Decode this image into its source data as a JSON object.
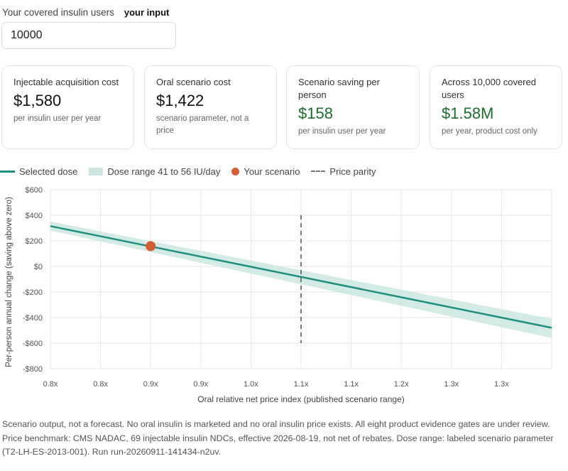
{
  "input": {
    "label": "Your covered insulin users",
    "hint": "your input",
    "value": "10000"
  },
  "cards": [
    {
      "label": "Injectable acquisition cost",
      "value": "$1,580",
      "note": "per insulin user per year",
      "accent": "#111111"
    },
    {
      "label": "Oral scenario cost",
      "value": "$1,422",
      "note": "scenario parameter, not a price",
      "accent": "#111111"
    },
    {
      "label": "Scenario saving per person",
      "value": "$158",
      "note": "per insulin user per year",
      "accent": "#1d6e2a"
    },
    {
      "label": "Across 10,000 covered users",
      "value": "$1.58M",
      "note": "per year, product cost only",
      "accent": "#1d6e2a"
    }
  ],
  "legend": {
    "selected": "Selected dose",
    "range": "Dose range 41 to 56 IU/day",
    "scenario": "Your scenario",
    "parity": "Price parity"
  },
  "colors": {
    "line": "#1f8f7e",
    "band": "#cde6e1",
    "point": "#d65c31",
    "parity": "#777777",
    "grid": "#e6e6e6"
  },
  "chart_data": {
    "type": "line",
    "xlabel": "Oral relative net price index (published scenario range)",
    "ylabel": "Per-person annual change (saving above zero)",
    "xlim": [
      0.5,
      1.5
    ],
    "ylim": [
      -800,
      600
    ],
    "x_ticks": [
      0.5,
      0.6,
      0.7,
      0.8,
      0.9,
      1.0,
      1.1,
      1.2,
      1.3,
      1.4,
      1.5
    ],
    "x_tick_labels": [
      "0.8x",
      "0.8x",
      "0.9x",
      "0.9x",
      "1.0x",
      "1.1x",
      "1.1x",
      "1.2x",
      "1.3x",
      "1.3x"
    ],
    "y_ticks": [
      600,
      400,
      200,
      0,
      -200,
      -400,
      -600,
      -800
    ],
    "y_tick_labels": [
      "$600",
      "$400",
      "$200",
      "$0",
      "-$200",
      "-$400",
      "-$600",
      "-$800"
    ],
    "grid": true,
    "legend_position": "top",
    "series": [
      {
        "name": "Selected dose",
        "x": [
          0.5,
          1.5
        ],
        "y": [
          315,
          -480
        ]
      }
    ],
    "band": {
      "name": "Dose range 41 to 56 IU/day",
      "x": [
        0.5,
        1.5
      ],
      "upper": [
        350,
        -410
      ],
      "lower": [
        280,
        -560
      ]
    },
    "point": {
      "name": "Your scenario",
      "x": 0.7,
      "y": 158
    },
    "parity": {
      "name": "Price parity",
      "x": 1.0,
      "y_range": [
        -600,
        400
      ]
    }
  },
  "footer": "Scenario output, not a forecast. No oral insulin is marketed and no oral insulin price exists. All eight product evidence gates are under review. Price benchmark: CMS NADAC, 69 injectable insulin NDCs, effective 2026-08-19, not net of rebates. Dose range: labeled scenario parameter (T2-LH-ES-2013-001). Run run-20260911-141434-n2uv."
}
